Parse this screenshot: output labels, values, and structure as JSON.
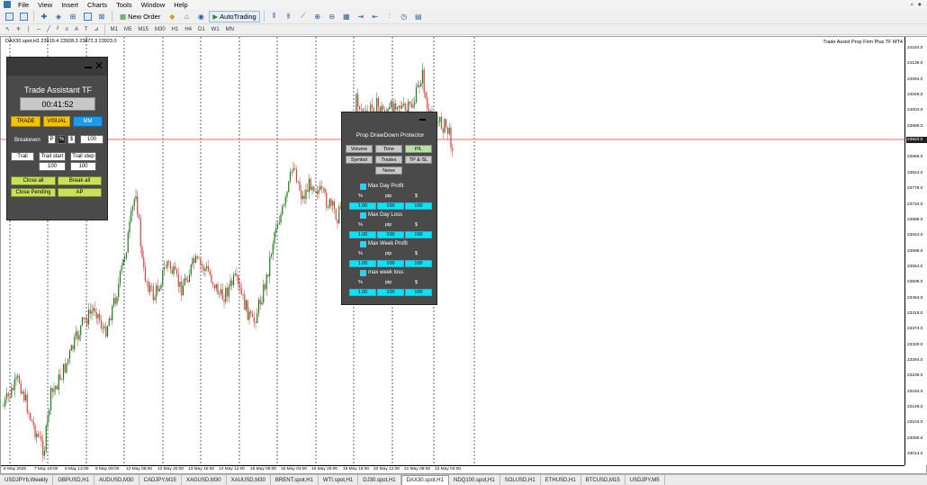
{
  "menu": {
    "items": [
      "File",
      "View",
      "Insert",
      "Charts",
      "Tools",
      "Window",
      "Help"
    ]
  },
  "toolbar": {
    "new_order": "New Order",
    "auto_trading": "AutoTrading"
  },
  "timeframes": [
    "M1",
    "M5",
    "M15",
    "M30",
    "H1",
    "H4",
    "D1",
    "W1",
    "MN"
  ],
  "chart": {
    "label": "DAX30.spot,H1  23919.4 23928.3 23872.3 23923.0",
    "ea_label": "Trade Assist Prop Firm Plus TF MT4",
    "current_price": "23923.0",
    "price_ticks": [
      "24184.0",
      "24139.0",
      "24094.0",
      "24049.0",
      "24004.0",
      "23959.0",
      "23914.0",
      "23869.0",
      "23824.0",
      "23779.0",
      "23734.0",
      "23689.0",
      "23644.0",
      "23599.0",
      "23554.0",
      "23509.0",
      "23464.0",
      "23419.0",
      "23374.0",
      "23329.0",
      "23284.0",
      "23239.0",
      "23194.0",
      "23149.0",
      "23104.0",
      "23059.0",
      "23014.0"
    ],
    "time_ticks": [
      "6 May 2025",
      "7 May 16:00",
      "8 May 12:00",
      "9 May 08:00",
      "12 May 08:00",
      "12 May 20:00",
      "13 May 16:00",
      "14 May 12:00",
      "15 May 08:00",
      "16 May 04:00",
      "16 May 20:00",
      "19 May 16:00",
      "20 May 12:00",
      "21 May 08:00",
      "22 May 04:00"
    ],
    "colors": {
      "bull": "#1a7a1a",
      "bear": "#e33b3b",
      "hline": "#e33b3b"
    }
  },
  "trade_assistant": {
    "title": "Trade Assistant TF",
    "timer": "00:41:52",
    "trade": "TRADE",
    "visual": "VISUAL",
    "mm": "MM",
    "breakeven": "Breakeven",
    "p": "P",
    "pct": "%",
    "dollar": "$",
    "be_value": "100",
    "trail": "Trail",
    "trail_start": "Trail start",
    "trail_step": "Trail step",
    "trail_start_value": "100",
    "trail_step_value": "100",
    "close_all": "Close all",
    "break_all": "Break all",
    "close_pending": "Close Pending",
    "ap": "AP"
  },
  "prop": {
    "title": "Prop DrawDown Protector",
    "buttons": [
      "Volume",
      "Time",
      "P/L",
      "Symbol",
      "Trades",
      "TP & SL",
      "News"
    ],
    "sections": [
      {
        "label": "Max Day Profit",
        "pct": "%",
        "pip": "pip",
        "usd": "$",
        "v1": "1.00",
        "v2": "100",
        "v3": "100"
      },
      {
        "label": "Max Day Loss",
        "pct": "%",
        "pip": "pip",
        "usd": "$",
        "v1": "1.00",
        "v2": "100",
        "v3": "100"
      },
      {
        "label": "Max Week Profit",
        "pct": "%",
        "pip": "pip",
        "usd": "$",
        "v1": "1.00",
        "v2": "100",
        "v3": "100"
      },
      {
        "label": "max week loss",
        "pct": "%",
        "pip": "pip",
        "usd": "$",
        "v1": "1.00",
        "v2": "100",
        "v3": "100"
      }
    ]
  },
  "tabs": [
    "USDJPYb,Weekly",
    "GBPUSD,H1",
    "AUDUSD,M30",
    "CADJPY,M15",
    "XAGUSD,M30",
    "XAUUSD,M30",
    "BRENT.spot,H1",
    "WTI.spot,H1",
    "DJ30.spot,H1",
    "DAX30.spot,H1",
    "NDQ100.spot,H1",
    "SOLUSD,H1",
    "ETHUSD,H1",
    "BTCUSD,M15",
    "USDJPY,M5"
  ],
  "active_tab": "DAX30.spot,H1"
}
